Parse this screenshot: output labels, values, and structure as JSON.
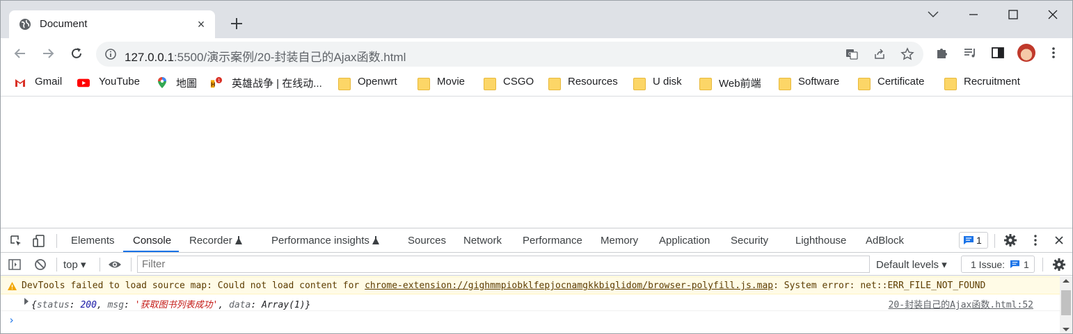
{
  "tab": {
    "title": "Document",
    "close": "×"
  },
  "omnibox": {
    "host": "127.0.0.1",
    "path": ":5500/演示案例/20-封装自己的Ajax函数.html"
  },
  "bookmarks": [
    {
      "label": "Gmail",
      "icon": "gmail-icon"
    },
    {
      "label": "YouTube",
      "icon": "youtube-icon"
    },
    {
      "label": "地圖",
      "icon": "maps-icon"
    },
    {
      "label": "英雄战争 | 在线动...",
      "icon": "game-icon"
    },
    {
      "label": "Openwrt",
      "icon": "folder-icon"
    },
    {
      "label": "Movie",
      "icon": "folder-icon"
    },
    {
      "label": "CSGO",
      "icon": "folder-icon"
    },
    {
      "label": "Resources",
      "icon": "folder-icon"
    },
    {
      "label": "U disk",
      "icon": "folder-icon"
    },
    {
      "label": "Web前端",
      "icon": "folder-icon"
    },
    {
      "label": "Software",
      "icon": "folder-icon"
    },
    {
      "label": "Certificate",
      "icon": "folder-icon"
    },
    {
      "label": "Recruitment",
      "icon": "folder-icon"
    }
  ],
  "devtools": {
    "tabs": [
      "Elements",
      "Console",
      "Recorder",
      "Performance insights",
      "Sources",
      "Network",
      "Performance",
      "Memory",
      "Application",
      "Security",
      "Lighthouse",
      "AdBlock"
    ],
    "active_tab": "Console",
    "message_count": "1",
    "context": "top",
    "filter_placeholder": "Filter",
    "levels": "Default levels",
    "issues_label": "1 Issue:",
    "issues_count": "1"
  },
  "console": {
    "warning": {
      "prefix": "DevTools failed to load source map: Could not load content for ",
      "link": "chrome-extension://gighmmpiobklfepjocnamgkkbiglidom/browser-polyfill.js.map",
      "suffix": ": System error: net::ERR_FILE_NOT_FOUND"
    },
    "log": {
      "open": "{",
      "k1": "status",
      "v1": "200",
      "k2": "msg",
      "v2": "'获取图书列表成功'",
      "k3": "data",
      "v3": "Array(1)",
      "close": "}",
      "source": "20-封装自己的Ajax函数.html:52"
    },
    "prompt": "›"
  },
  "colors": {
    "accent": "#1a73e8",
    "warning_bg": "#fffbe6",
    "tabstrip": "#dee1e6"
  }
}
